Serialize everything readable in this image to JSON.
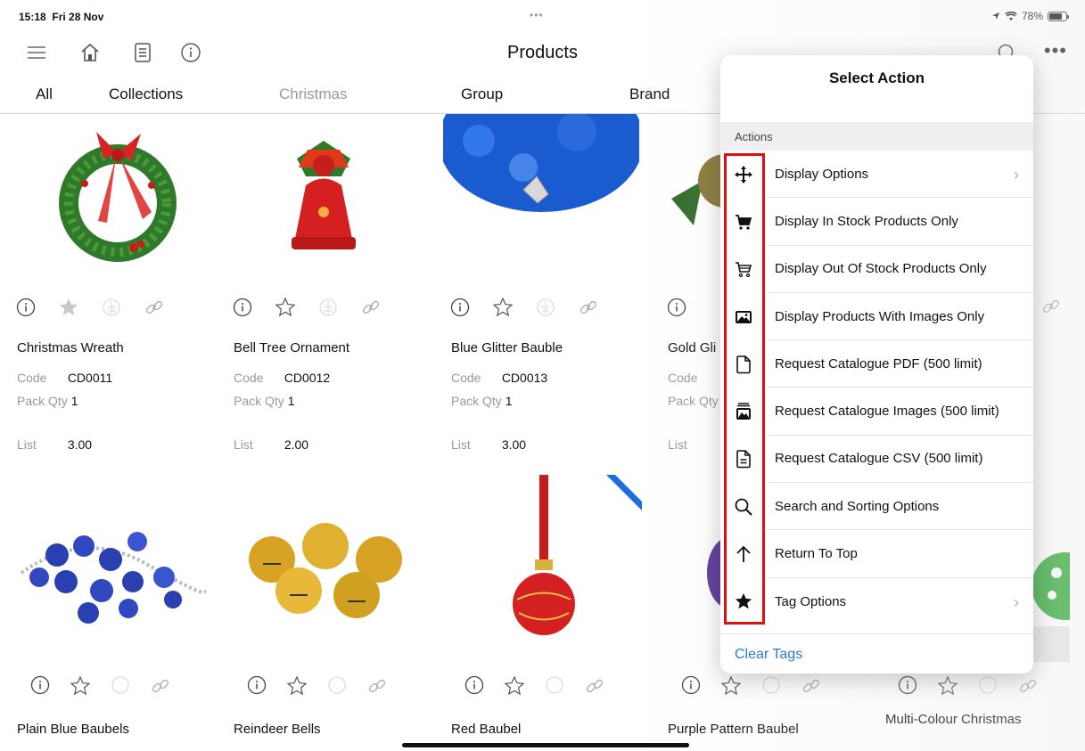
{
  "status": {
    "time": "15:18",
    "date": "Fri 28 Nov",
    "dots": "•••",
    "battery": "78%",
    "battery_level": 0.78
  },
  "nav": {
    "title": "Products",
    "more": "•••"
  },
  "tabs": [
    {
      "label": "All"
    },
    {
      "label": "Collections"
    },
    {
      "label": "Christmas"
    },
    {
      "label": "Group"
    },
    {
      "label": "Brand"
    }
  ],
  "labels": {
    "code": "Code",
    "pack_qty": "Pack Qty",
    "list": "List"
  },
  "products": [
    {
      "name": "Christmas Wreath",
      "code": "CD0011",
      "pack_qty": "1",
      "list": "3.00",
      "favorite": true
    },
    {
      "name": "Bell Tree Ornament",
      "code": "CD0012",
      "pack_qty": "1",
      "list": "2.00",
      "favorite": false
    },
    {
      "name": "Blue Glitter Bauble",
      "code": "CD0013",
      "pack_qty": "1",
      "list": "3.00",
      "favorite": false
    },
    {
      "name": "Gold Gli",
      "code": "",
      "pack_qty": "",
      "list": "",
      "favorite": false
    }
  ],
  "products_row2": [
    {
      "name": "Plain Blue Baubels"
    },
    {
      "name": "Reindeer Bells"
    },
    {
      "name": "Red Baubel"
    },
    {
      "name": "Purple Pattern Baubel"
    },
    {
      "name": "Multi-Colour Christmas"
    }
  ],
  "popover": {
    "title": "Select Action",
    "section": "Actions",
    "items": [
      {
        "label": "Display Options",
        "icon": "move-arrows-icon",
        "chevron": "›"
      },
      {
        "label": "Display In Stock Products Only",
        "icon": "cart-filled-icon"
      },
      {
        "label": "Display Out Of Stock Products Only",
        "icon": "cart-outline-icon"
      },
      {
        "label": "Display Products With Images Only",
        "icon": "image-icon"
      },
      {
        "label": "Request Catalogue PDF (500 limit)",
        "icon": "document-icon"
      },
      {
        "label": "Request Catalogue Images (500 limit)",
        "icon": "images-stack-icon"
      },
      {
        "label": "Request Catalogue CSV (500 limit)",
        "icon": "text-document-icon"
      },
      {
        "label": "Search and Sorting Options",
        "icon": "search-icon"
      },
      {
        "label": "Return To Top",
        "icon": "arrow-up-icon"
      },
      {
        "label": "Tag Options",
        "icon": "star-filled-icon",
        "chevron": "›"
      }
    ],
    "clear_tags": "Clear Tags"
  },
  "colors": {
    "accent": "#2a7bd6",
    "highlight": "#e01010"
  }
}
